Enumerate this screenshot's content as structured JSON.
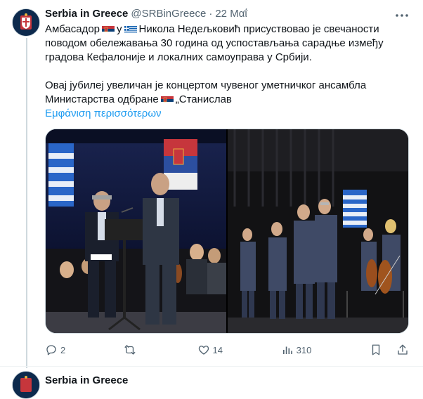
{
  "tweet": {
    "author_name": "Serbia in Greece",
    "handle": "@SRBinGreece",
    "separator": "·",
    "date": "22 Μαΐ",
    "text_line1_a": "Амбасадор",
    "text_line1_b": "у",
    "text_line1_c": "Никола Недељковић присуствовао је свечаности",
    "text_line2": "поводом обележавања 30 година од успостављања сарадње између",
    "text_line3": "градова Кефалоније и локалних самоуправа у Србији.",
    "text_line4": "Овај јубилеј увеличан је концертом чувеног уметничког ансамбла",
    "text_line5_a": "Министарства одбране",
    "text_line5_b": "„Станислав",
    "show_more": "Εμφάνιση περισσότερων",
    "flags": [
      "serbia-flag",
      "greece-flag"
    ]
  },
  "actions": {
    "reply_count": "2",
    "retweet_count": "",
    "like_count": "14",
    "view_count": "310"
  },
  "next_tweet": {
    "author_name": "Serbia in Greece"
  },
  "colors": {
    "text": "#0f1419",
    "secondary": "#536471",
    "link": "#1d9bf0",
    "border": "#cfd9de"
  },
  "icons": [
    "more-icon",
    "reply-icon",
    "retweet-icon",
    "like-icon",
    "views-icon",
    "bookmark-icon",
    "share-icon"
  ]
}
